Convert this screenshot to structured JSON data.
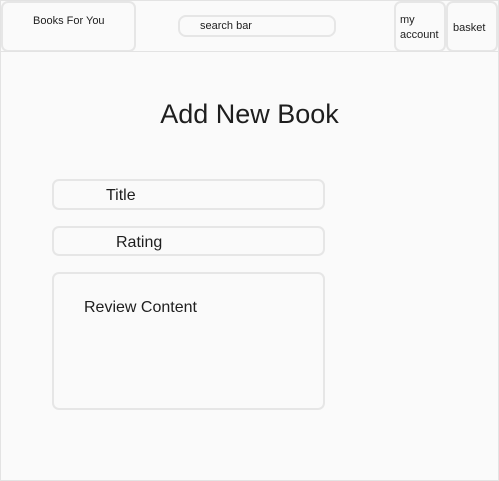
{
  "header": {
    "brand": "Books For You",
    "search_placeholder": "search bar",
    "account_label": "my account",
    "basket_label": "basket"
  },
  "main": {
    "title": "Add New Book",
    "fields": {
      "title_placeholder": "Title",
      "rating_placeholder": "Rating",
      "review_placeholder": "Review Content"
    }
  }
}
